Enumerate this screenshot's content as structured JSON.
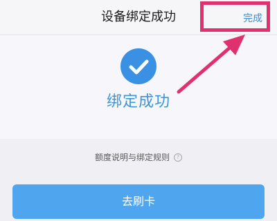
{
  "nav": {
    "title": "设备绑定成功",
    "done_label": "完成"
  },
  "success": {
    "icon": "check-icon",
    "message": "绑定成功"
  },
  "info": {
    "rules_text": "额度说明与绑定规则",
    "help_icon": "question-icon"
  },
  "actions": {
    "primary_label": "去刷卡"
  },
  "colors": {
    "accent_blue": "#3a91e3",
    "button_blue": "#4fa6ef",
    "annotation_pink": "#e0306e"
  }
}
